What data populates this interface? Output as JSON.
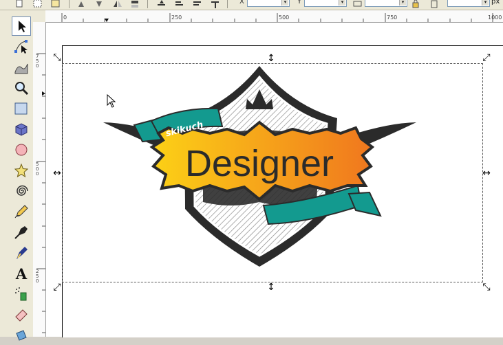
{
  "toolbar": {
    "x_label": "X",
    "y_label": "Y",
    "unit": "px"
  },
  "ruler": {
    "h_labels": [
      "0",
      "250",
      "500",
      "750",
      "1000"
    ],
    "v_labels": [
      "750",
      "500",
      "250"
    ]
  },
  "tools": [
    {
      "name": "selector-tool",
      "icon": "arrow-icon",
      "active": true
    },
    {
      "name": "node-tool",
      "icon": "node-icon"
    },
    {
      "name": "tweak-tool",
      "icon": "tweak-icon"
    },
    {
      "name": "zoom-tool",
      "icon": "zoom-icon"
    },
    {
      "name": "rect-tool",
      "icon": "rectangle-icon"
    },
    {
      "name": "3dbox-tool",
      "icon": "cube-icon"
    },
    {
      "name": "ellipse-tool",
      "icon": "ellipse-icon"
    },
    {
      "name": "star-tool",
      "icon": "star-icon"
    },
    {
      "name": "spiral-tool",
      "icon": "spiral-icon"
    },
    {
      "name": "pencil-tool",
      "icon": "pencil-icon"
    },
    {
      "name": "pen-tool",
      "icon": "pen-icon"
    },
    {
      "name": "calligraphy-tool",
      "icon": "calligraphy-icon"
    },
    {
      "name": "text-tool",
      "icon": "text-icon",
      "glyph": "A"
    },
    {
      "name": "spray-tool",
      "icon": "spray-icon"
    },
    {
      "name": "eraser-tool",
      "icon": "eraser-icon"
    },
    {
      "name": "bucket-tool",
      "icon": "bucket-icon"
    }
  ],
  "artwork": {
    "banner_text": "Designer",
    "ribbon_text": "skikuch",
    "colors": {
      "dark": "#2b2b2b",
      "teal": "#139a8f",
      "gold_start": "#fcd116",
      "gold_end": "#f0771e"
    }
  }
}
